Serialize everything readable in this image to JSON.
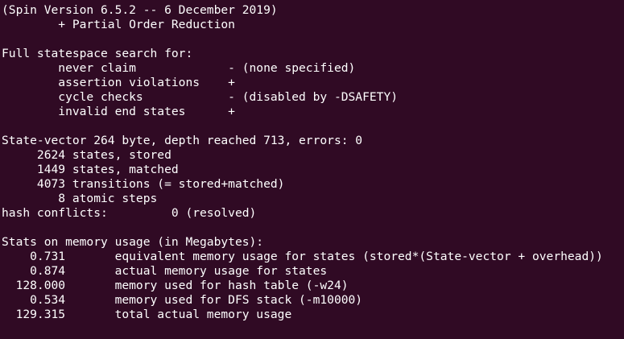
{
  "terminal": {
    "background": "#300a24",
    "foreground": "#ffffff",
    "lines": [
      "(Spin Version 6.5.2 -- 6 December 2019)",
      "        + Partial Order Reduction",
      "",
      "Full statespace search for:",
      "        never claim             - (none specified)",
      "        assertion violations    +",
      "        cycle checks            - (disabled by -DSAFETY)",
      "        invalid end states      +",
      "",
      "State-vector 264 byte, depth reached 713, errors: 0",
      "     2624 states, stored",
      "     1449 states, matched",
      "     4073 transitions (= stored+matched)",
      "        8 atomic steps",
      "hash conflicts:         0 (resolved)",
      "",
      "Stats on memory usage (in Megabytes):",
      "    0.731       equivalent memory usage for states (stored*(State-vector + overhead))",
      "    0.874       actual memory usage for states",
      "  128.000       memory used for hash table (-w24)",
      "    0.534       memory used for DFS stack (-m10000)",
      "  129.315       total actual memory usage"
    ]
  }
}
